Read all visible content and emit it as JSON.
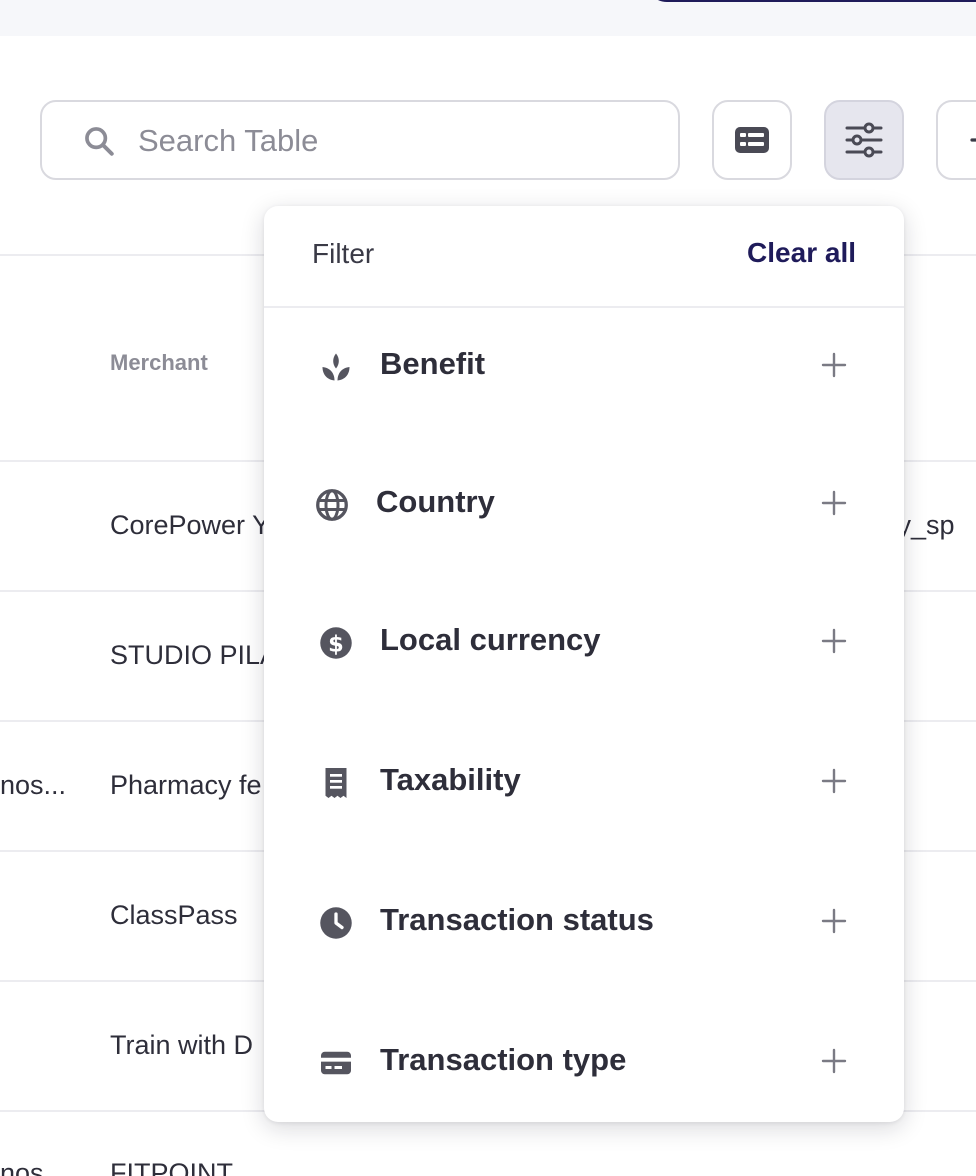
{
  "search": {
    "placeholder": "Search Table",
    "value": ""
  },
  "toolbar": {
    "view_icon": "table-view-icon",
    "filter_icon": "sliders-filter-icon",
    "add_icon": "plus-icon"
  },
  "table": {
    "columns": [
      "Merchant"
    ],
    "rows": [
      {
        "left": "",
        "merchant": "CorePower Y",
        "right": "ty_sp"
      },
      {
        "left": "",
        "merchant": "STUDIO PILA",
        "right": ""
      },
      {
        "left": "nos...",
        "merchant": "Pharmacy fe",
        "right": ""
      },
      {
        "left": "",
        "merchant": "ClassPass",
        "right": ""
      },
      {
        "left": "",
        "merchant": "Train with D",
        "right": ""
      },
      {
        "left": "nos",
        "merchant": "FITPOINT",
        "right": ""
      }
    ]
  },
  "filter_menu": {
    "title": "Filter",
    "clear_label": "Clear all",
    "items": [
      {
        "label": "Benefit",
        "icon": "sprout-icon"
      },
      {
        "label": "Country",
        "icon": "globe-icon"
      },
      {
        "label": "Local currency",
        "icon": "dollar-circle-icon"
      },
      {
        "label": "Taxability",
        "icon": "receipt-icon"
      },
      {
        "label": "Transaction status",
        "icon": "clock-icon"
      },
      {
        "label": "Transaction type",
        "icon": "credit-card-icon"
      }
    ]
  },
  "colors": {
    "accent": "#1f1b5a",
    "icon": "#55555f",
    "text": "#2e2e3a",
    "muted": "#8c8c96"
  }
}
